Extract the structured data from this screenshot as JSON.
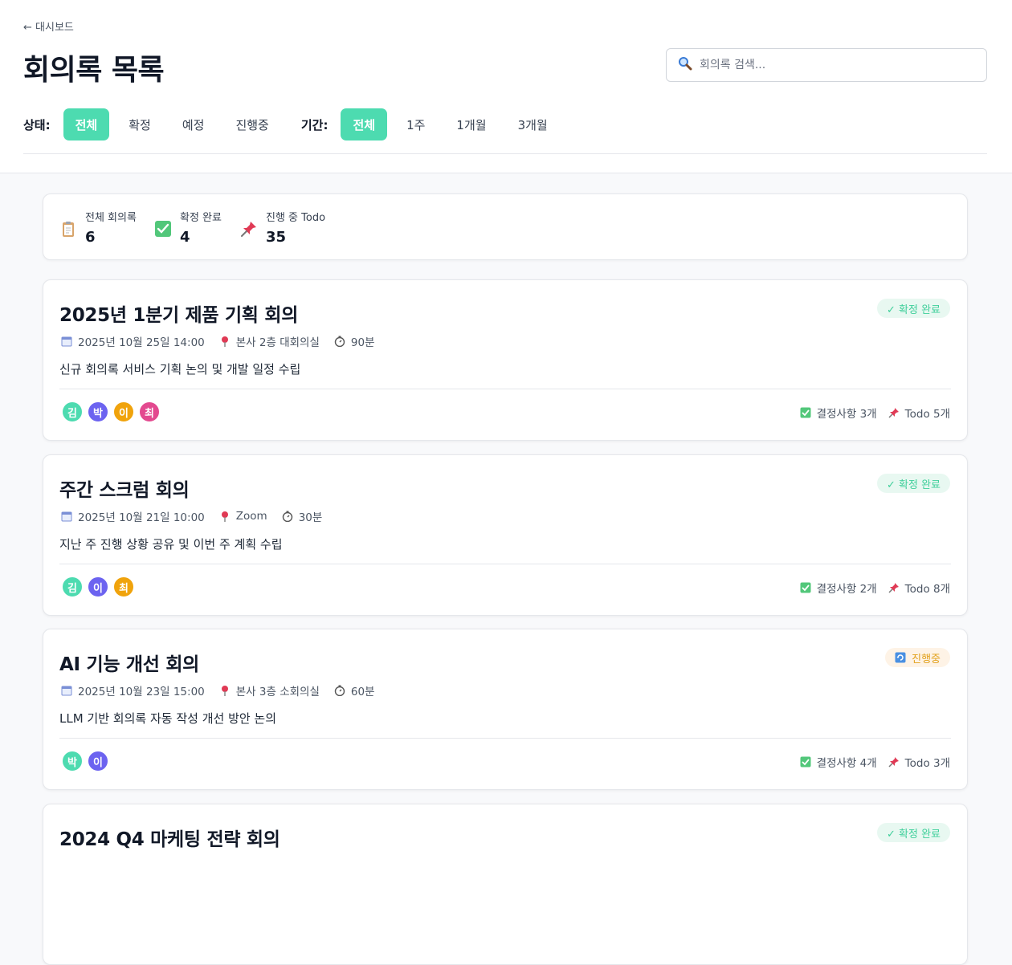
{
  "nav": {
    "back_label": "← 대시보드"
  },
  "header": {
    "title": "회의록 목록"
  },
  "search": {
    "placeholder": "회의록 검색..."
  },
  "filters": {
    "status_label": "상태:",
    "status_options": [
      "전체",
      "확정",
      "예정",
      "진행중"
    ],
    "status_selected": "전체",
    "period_label": "기간:",
    "period_options": [
      "전체",
      "1주",
      "1개월",
      "3개월"
    ],
    "period_selected": "전체"
  },
  "stats": [
    {
      "label": "전체 회의록",
      "value": "6",
      "icon": "clipboard-icon"
    },
    {
      "label": "확정 완료",
      "value": "4",
      "icon": "check-box-icon"
    },
    {
      "label": "진행 중 Todo",
      "value": "35",
      "icon": "pushpin-icon"
    }
  ],
  "meetings": [
    {
      "title": "2025년 1분기 제품 기획 회의",
      "status": "✓ 확정 완료",
      "status_type": "done",
      "date": "2025년 10월 25일 14:00",
      "location": "본사 2층 대회의실",
      "duration": "90분",
      "description": "신규 회의록 서비스 기획 논의 및 개발 일정 수립",
      "participants": [
        "김",
        "박",
        "이",
        "최"
      ],
      "decisions": "결정사항 3개",
      "todos": "Todo 5개"
    },
    {
      "title": "주간 스크럼 회의",
      "status": "✓ 확정 완료",
      "status_type": "done",
      "date": "2025년 10월 21일 10:00",
      "location": "Zoom",
      "duration": "30분",
      "description": "지난 주 진행 상황 공유 및 이번 주 계획 수립",
      "participants": [
        "김",
        "이",
        "최"
      ],
      "decisions": "결정사항 2개",
      "todos": "Todo 8개"
    },
    {
      "title": "AI 기능 개선 회의",
      "status": "진행중",
      "status_type": "prog",
      "date": "2025년 10월 23일 15:00",
      "location": "본사 3층 소회의실",
      "duration": "60분",
      "description": "LLM 기반 회의록 자동 작성 개선 방안 논의",
      "participants": [
        "박",
        "이"
      ],
      "decisions": "결정사항 4개",
      "todos": "Todo 3개"
    },
    {
      "title": "2024 Q4 마케팅 전략 회의",
      "status": "✓ 확정 완료",
      "status_type": "done",
      "date": "",
      "location": "",
      "duration": "",
      "description": "",
      "participants": [],
      "decisions": "",
      "todos": ""
    }
  ],
  "colors": {
    "accent": "#4ddbb0",
    "avatar_kim": "#4ddbb0",
    "avatar_park": "#6c63f0",
    "avatar_lee_first": "#f0a30c",
    "avatar_choi": "#e3498f",
    "avatar_lee": "#6c63f0",
    "avatar_choi_alt": "#f0a30c"
  }
}
